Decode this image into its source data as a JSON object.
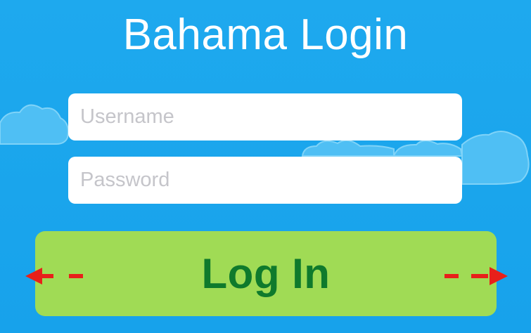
{
  "title": "Bahama Login",
  "username": {
    "placeholder": "Username",
    "value": ""
  },
  "password": {
    "placeholder": "Password",
    "value": ""
  },
  "login_button": {
    "label": "Log In"
  },
  "colors": {
    "background": "#1ea9ee",
    "title_text": "#ffffff",
    "button_bg": "#a0db55",
    "button_text": "#0f7a2c",
    "arrow": "#e8201a"
  }
}
